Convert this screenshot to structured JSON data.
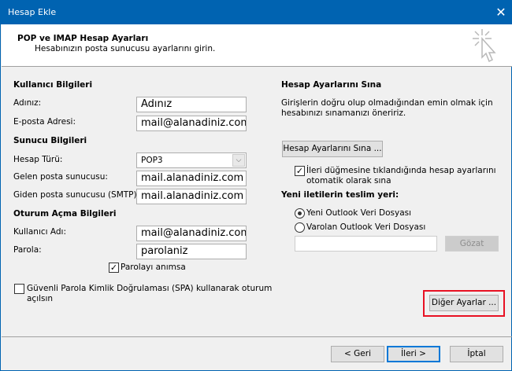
{
  "window": {
    "title": "Hesap Ekle",
    "close_icon": "close-icon"
  },
  "header": {
    "title": "POP ve IMAP Hesap Ayarları",
    "subtitle": "Hesabınızın posta sunucusu ayarlarını girin."
  },
  "left": {
    "user_info": "Kullanıcı Bilgileri",
    "name_label": "Adınız:",
    "name_value": "Adınız",
    "email_label": "E-posta Adresi:",
    "email_value": "mail@alanadiniz.com",
    "server_info": "Sunucu Bilgileri",
    "account_type_label": "Hesap Türü:",
    "account_type_value": "POP3",
    "incoming_label": "Gelen posta sunucusu:",
    "incoming_value": "mail.alanadiniz.com",
    "outgoing_label": "Giden posta sunucusu (SMTP):",
    "outgoing_value": "mail.alanadiniz.com",
    "logon_info": "Oturum Açma Bilgileri",
    "username_label": "Kullanıcı Adı:",
    "username_value": "mail@alanadiniz.com",
    "password_label": "Parola:",
    "password_value": "parolaniz",
    "remember_password": "Parolayı anımsa",
    "remember_checked": true,
    "spa_line1": "Güvenli Parola Kimlik Doğrulaması (SPA) kullanarak oturum",
    "spa_line2": "açılsın",
    "spa_checked": false
  },
  "right": {
    "test_heading": "Hesap Ayarlarını Sına",
    "test_desc1": "Girişlerin doğru olup olmadığından emin olmak için",
    "test_desc2": "hesabınızı sınamanızı öneririz.",
    "test_button": "Hesap Ayarlarını Sına ...",
    "auto_test_line1": "İleri düğmesine tıklandığında hesap ayarlarını",
    "auto_test_line2": "otomatik olarak sına",
    "auto_test_checked": true,
    "delivery_heading": "Yeni iletilerin teslim yeri:",
    "radio_new": "Yeni Outlook Veri Dosyası",
    "radio_existing": "Varolan Outlook Veri Dosyası",
    "selected": "new",
    "existing_path_value": "",
    "browse_button": "Gözat",
    "more_settings_button": "Diğer Ayarlar ...",
    "highlight_color": "#e81123"
  },
  "footer": {
    "back": "< Geri",
    "next": "İleri >",
    "cancel": "İptal"
  }
}
